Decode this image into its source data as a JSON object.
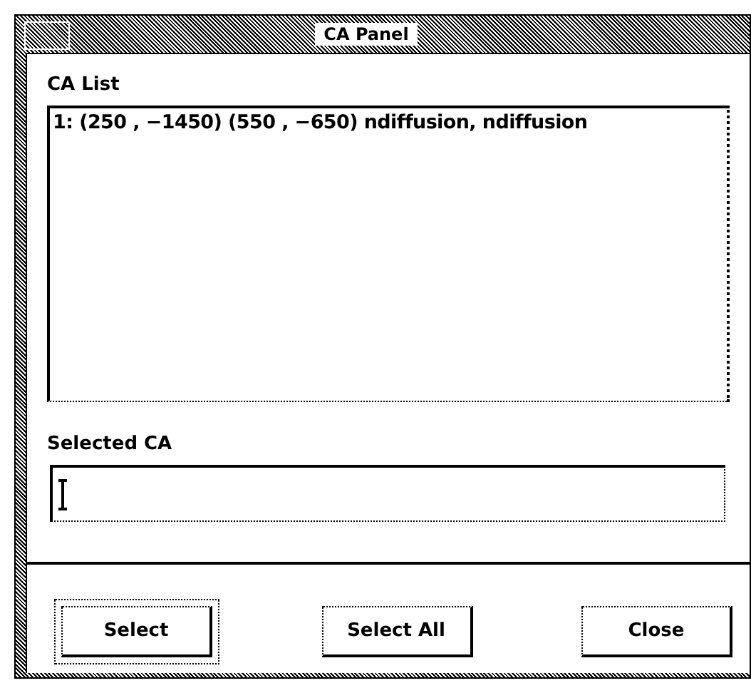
{
  "window": {
    "title": "CA Panel"
  },
  "ca_list": {
    "label": "CA List",
    "items": [
      "1: (250 , −1450) (550 , −650) ndiffusion, ndiffusion"
    ]
  },
  "selected_ca": {
    "label": "Selected CA"
  },
  "buttons": [
    {
      "label": "Select",
      "default": true
    },
    {
      "label": "Select All",
      "default": false
    },
    {
      "label": "Close",
      "default": false
    }
  ]
}
